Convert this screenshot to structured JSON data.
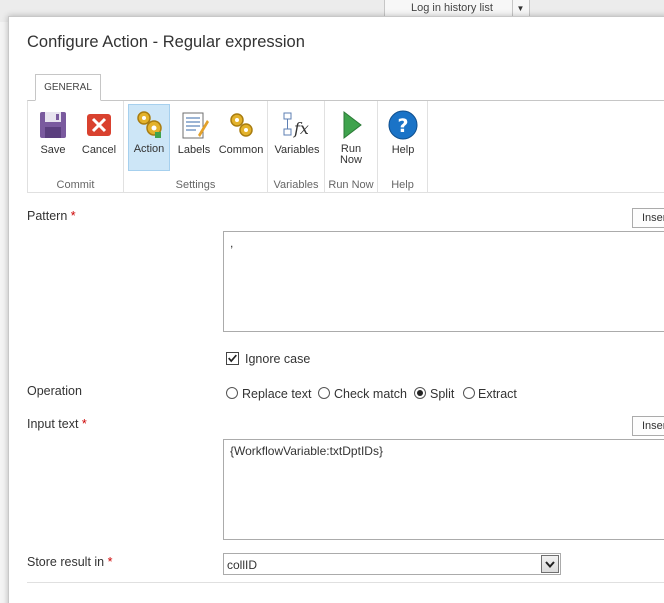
{
  "background": {
    "history_select": "Log in history list"
  },
  "dialog": {
    "title": "Configure Action - Regular expression"
  },
  "ribbon": {
    "tab_label": "GENERAL",
    "groups": {
      "commit": "Commit",
      "settings": "Settings",
      "variables": "Variables",
      "run_now": "Run Now",
      "help": "Help"
    },
    "buttons": {
      "save": "Save",
      "cancel": "Cancel",
      "action": "Action",
      "labels": "Labels",
      "common": "Common",
      "variables": "Variables",
      "run_now_line1": "Run",
      "run_now_line2": "Now",
      "help": "Help"
    }
  },
  "form": {
    "pattern": {
      "label": "Pattern",
      "required": "*",
      "value": ",",
      "insert_label": "Insert"
    },
    "ignore_case": {
      "label": "Ignore case",
      "checked": true
    },
    "operation": {
      "label": "Operation",
      "options": [
        "Replace text",
        "Check match",
        "Split",
        "Extract"
      ],
      "selected": "Split"
    },
    "input_text": {
      "label": "Input text",
      "required": "*",
      "value": "{WorkflowVariable:txtDptIDs}",
      "insert_label": "Insert"
    },
    "store_result": {
      "label": "Store result in",
      "required": "*",
      "value": "collID"
    }
  },
  "colors": {
    "accent": "#cde6f7",
    "required": "#cc0000",
    "help_blue": "#1a73c7",
    "run_green": "#3fa34d",
    "cancel_red": "#d9412f",
    "save_purple": "#7a5a9e"
  }
}
